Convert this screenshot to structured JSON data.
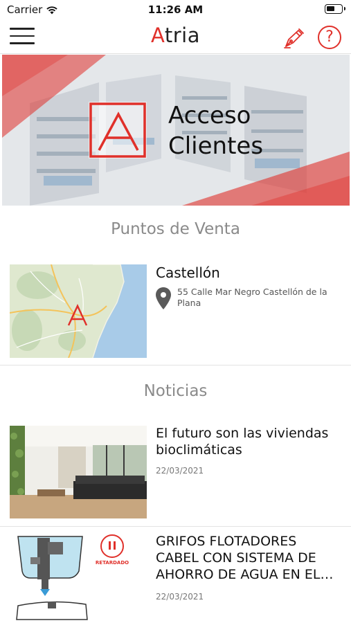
{
  "status_bar": {
    "carrier": "Carrier",
    "time": "11:26 AM",
    "battery_level": 0.55
  },
  "nav": {
    "logo_first": "A",
    "logo_rest": "tria",
    "menu_icon": "hamburger-menu-icon",
    "pen_icon": "fountain-pen-icon",
    "help_icon": "question-mark-icon",
    "help_label": "?"
  },
  "hero": {
    "title_line1": "Acceso",
    "title_line2": "Clientes"
  },
  "stores": {
    "section_title": "Puntos de Venta",
    "items": [
      {
        "name": "Castellón",
        "address": "55 Calle Mar Negro Castellón de la Plana"
      }
    ]
  },
  "news": {
    "section_title": "Noticias",
    "items": [
      {
        "title": "El futuro son las viviendas bioclimáticas",
        "date": "22/03/2021"
      },
      {
        "title": "GRIFOS FLOTADORES CABEL CON SISTEMA DE AHORRO DE AGUA EN EL…",
        "date": "22/03/2021",
        "badge": "RETARDADO"
      }
    ]
  },
  "colors": {
    "brand_red": "#e0302a",
    "section_gray": "#8a8a8a",
    "map_sea": "#a8cbe8",
    "map_land": "#dfe8cf"
  }
}
